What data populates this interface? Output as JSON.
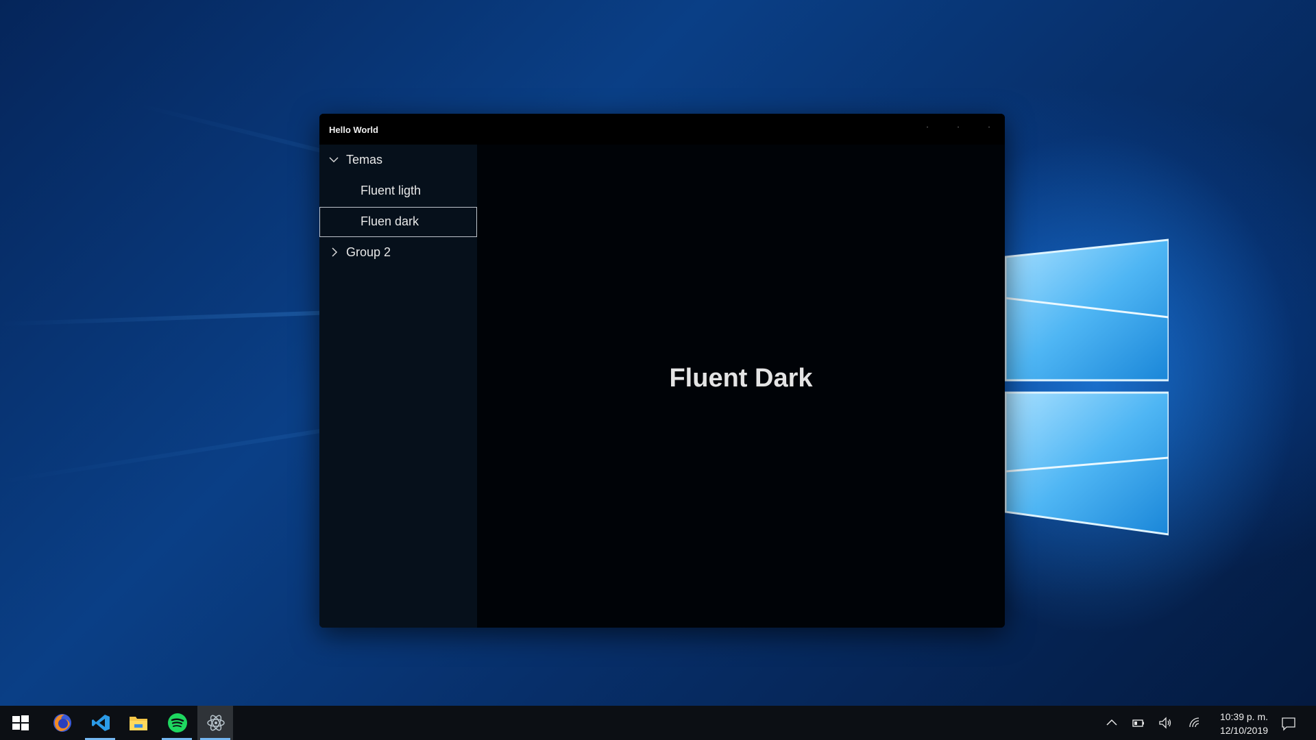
{
  "window": {
    "title": "Hello World",
    "controls": {
      "minimize": "·",
      "maximize": "·",
      "close": "·"
    }
  },
  "nav": {
    "group1": {
      "label": "Temas",
      "expanded": true,
      "icon": "chevron-down-icon"
    },
    "items": [
      {
        "label": "Fluent ligth",
        "selected": false
      },
      {
        "label": "Fluen dark",
        "selected": true
      }
    ],
    "group2": {
      "label": "Group 2",
      "expanded": false,
      "icon": "chevron-right-icon"
    }
  },
  "content": {
    "heading": "Fluent Dark"
  },
  "taskbar": {
    "apps": [
      {
        "name": "start-icon"
      },
      {
        "name": "firefox-icon"
      },
      {
        "name": "vscode-icon",
        "running": true
      },
      {
        "name": "file-explorer-icon"
      },
      {
        "name": "spotify-icon",
        "running": true
      },
      {
        "name": "electron-icon",
        "running": true,
        "active": true
      }
    ],
    "clock": {
      "time": "10:39 p. m.",
      "date": "12/10/2019"
    }
  },
  "colors": {
    "accent": "#74b6f0",
    "window_bg": "#000307",
    "nav_bg": "#06101b"
  }
}
